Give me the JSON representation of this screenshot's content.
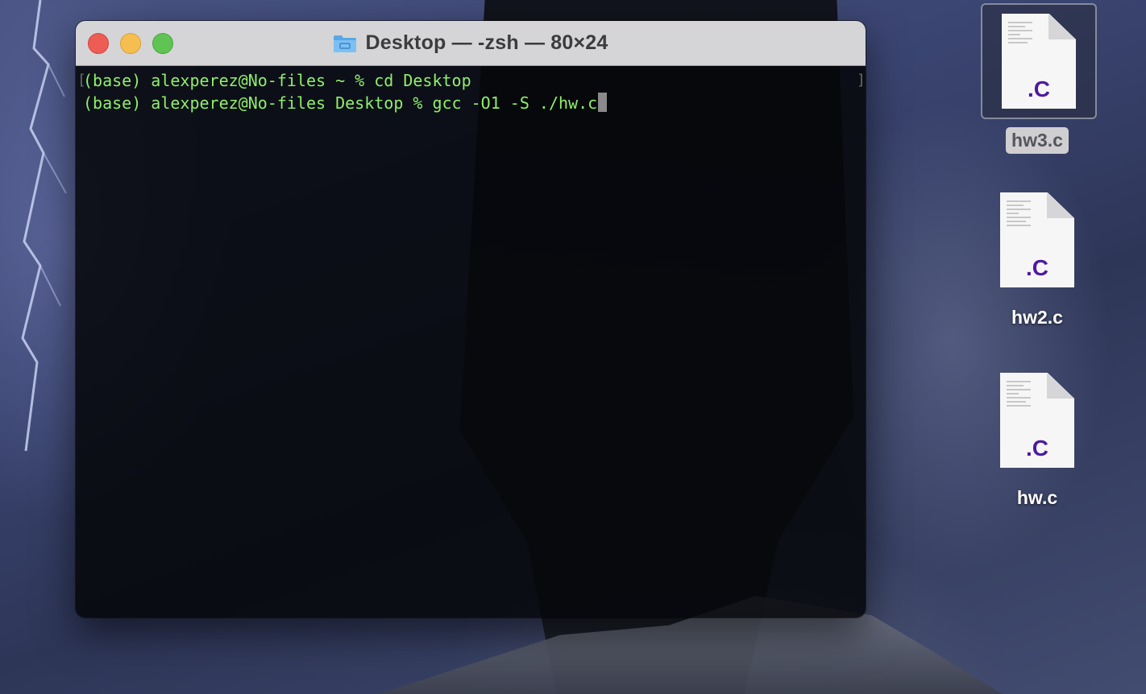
{
  "terminal": {
    "title": "Desktop — -zsh — 80×24",
    "lines": [
      "(base) alexperez@No-files ~ % cd Desktop",
      "(base) alexperez@No-files Desktop % gcc -O1 -S ./hw.c"
    ]
  },
  "desktop": {
    "files": [
      {
        "name": "hw3.c",
        "ext": ".C",
        "selected": true
      },
      {
        "name": "hw2.c",
        "ext": ".C",
        "selected": false
      },
      {
        "name": "hw.c",
        "ext": ".C",
        "selected": false
      }
    ]
  },
  "colors": {
    "terminal_text": "#8ff06a",
    "close": "#ed5d55",
    "minimize": "#f5be4f",
    "maximize": "#60c454",
    "file_ext": "#4e1aa0"
  }
}
